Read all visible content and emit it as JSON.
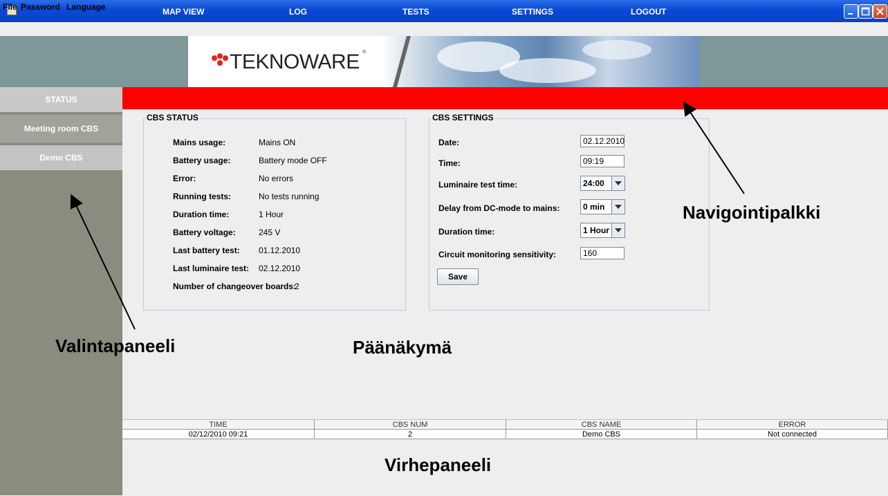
{
  "window": {
    "title": ""
  },
  "menu": [
    "File",
    "Password",
    "Language"
  ],
  "brand": {
    "name": "TEKNOWARE",
    "reg": "®",
    "color": "#e1251b"
  },
  "sidebar": {
    "status": "STATUS",
    "items": [
      "Meeting room CBS",
      "Demo CBS"
    ]
  },
  "nav": [
    "MAP VIEW",
    "LOG",
    "TESTS",
    "SETTINGS",
    "LOGOUT"
  ],
  "colors": {
    "nav_bg": "#ff0000",
    "sidebar_bg": "#8b8b80",
    "banner_bg": "#7e9899"
  },
  "cbs_status": {
    "title": "CBS STATUS",
    "rows": [
      {
        "label": "Mains usage:",
        "value": "Mains ON"
      },
      {
        "label": "Battery usage:",
        "value": "Battery mode OFF"
      },
      {
        "label": "Error:",
        "value": "No errors"
      },
      {
        "label": "Running tests:",
        "value": "No tests running"
      },
      {
        "label": "Duration time:",
        "value": "1 Hour"
      },
      {
        "label": "Battery voltage:",
        "value": "245 V"
      },
      {
        "label": "Last battery test:",
        "value": "01.12.2010"
      },
      {
        "label": "Last luminaire test:",
        "value": "02.12.2010"
      },
      {
        "label": "Number of changeover boards:",
        "value": "2"
      }
    ]
  },
  "cbs_settings": {
    "title": "CBS SETTINGS",
    "date": {
      "label": "Date:",
      "value": "02.12.2010"
    },
    "time": {
      "label": "Time:",
      "value": "09:19"
    },
    "luminaire": {
      "label": "Luminaire test time:",
      "value": "24:00"
    },
    "delay": {
      "label": "Delay from DC-mode to mains:",
      "value": "0 min"
    },
    "duration": {
      "label": "Duration time:",
      "value": "1 Hour"
    },
    "sensitivity": {
      "label": "Circuit monitoring sensitivity:",
      "value": "160"
    },
    "save": "Save"
  },
  "annotations": {
    "nav": "Navigointipalkki",
    "side": "Valintapaneeli",
    "main": "Päänäkymä",
    "error": "Virhepaneeli"
  },
  "error_table": {
    "headers": [
      "TIME",
      "CBS NUM",
      "CBS NAME",
      "ERROR"
    ],
    "rows": [
      [
        "02/12/2010 09:21",
        "2",
        "Demo CBS",
        "Not connected"
      ]
    ]
  }
}
